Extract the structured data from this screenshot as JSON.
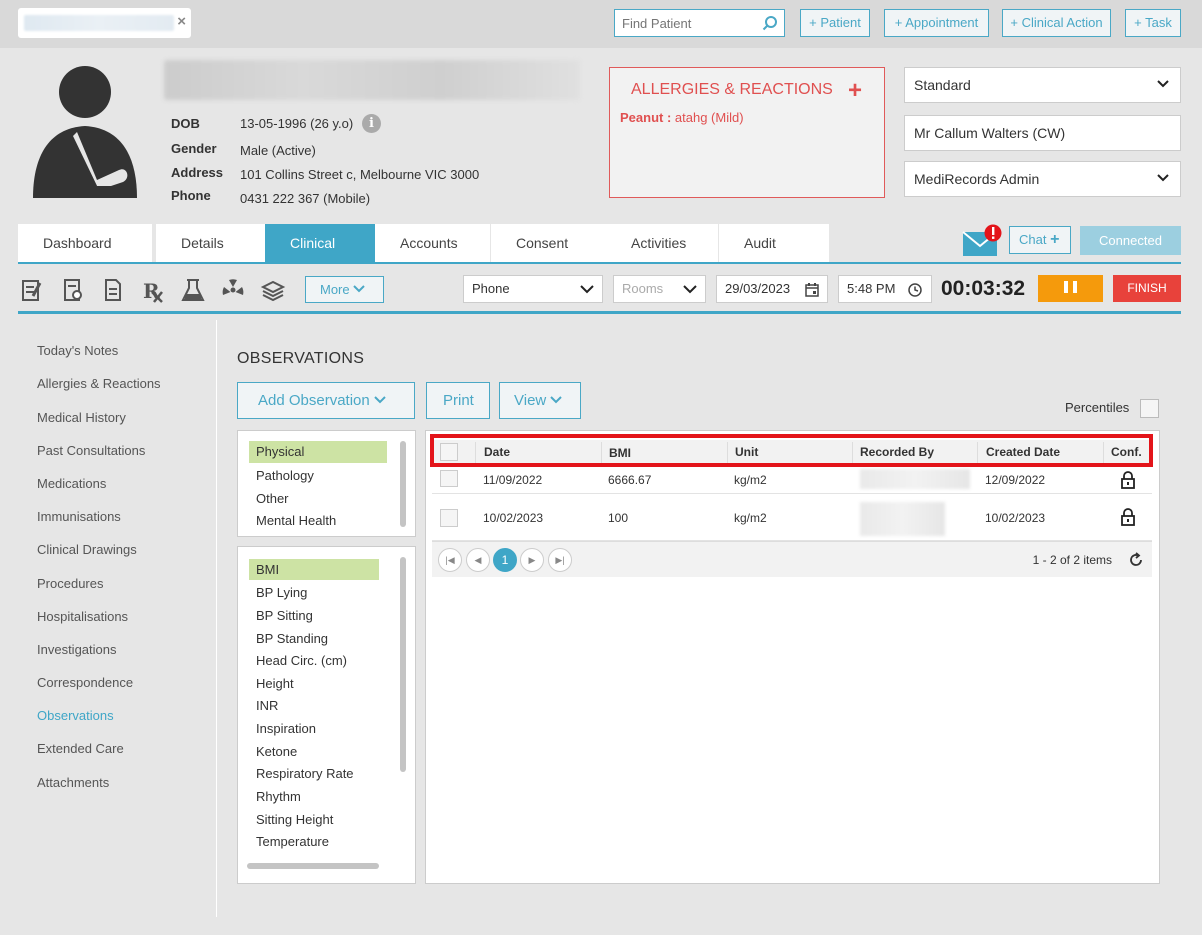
{
  "topbar": {
    "find_placeholder": "Find Patient",
    "buttons": [
      "+ Patient",
      "+ Appointment",
      "+ Clinical Action",
      "+ Task"
    ]
  },
  "patient": {
    "dob_label": "DOB",
    "dob": "13-05-1996 (26 y.o)",
    "gender_label": "Gender",
    "gender": "Male (Active)",
    "address_label": "Address",
    "address": "101 Collins Street c, Melbourne VIC 3000",
    "phone_label": "Phone",
    "phone": "0431 222 367 (Mobile)"
  },
  "allergies": {
    "title": "ALLERGIES & REACTIONS",
    "item_name": "Peanut : ",
    "item_detail": "atahg (Mild)"
  },
  "right_selects": {
    "standard": "Standard",
    "doctor": "Mr Callum Walters (CW)",
    "admin": "MediRecords Admin"
  },
  "tabs": [
    "Dashboard",
    "Details",
    "Clinical",
    "Accounts",
    "Consent",
    "Activities",
    "Audit"
  ],
  "active_tab": "Clinical",
  "chat_label": "Chat",
  "connected_label": "Connected",
  "toolbar": {
    "more_label": "More",
    "contact_type": "Phone",
    "rooms_placeholder": "Rooms",
    "date": "29/03/2023",
    "time": "5:48 PM",
    "timer": "00:03:32",
    "finish_label": "FINISH"
  },
  "sidebar": {
    "items": [
      "Today's Notes",
      "Allergies & Reactions",
      "Medical History",
      "Past Consultations",
      "Medications",
      "Immunisations",
      "Clinical Drawings",
      "Procedures",
      "Hospitalisations",
      "Investigations",
      "Correspondence",
      "Observations",
      "Extended Care",
      "Attachments"
    ],
    "active": "Observations"
  },
  "observations": {
    "title": "OBSERVATIONS",
    "add_label": "Add Observation",
    "print_label": "Print",
    "view_label": "View",
    "percentiles_label": "Percentiles",
    "categories": [
      "Physical",
      "Pathology",
      "Other",
      "Mental Health"
    ],
    "selected_category": "Physical",
    "types": [
      "BMI",
      "BP Lying",
      "BP Sitting",
      "BP Standing",
      "Head Circ. (cm)",
      "Height",
      "INR",
      "Inspiration",
      "Ketone",
      "Respiratory Rate",
      "Rhythm",
      "Sitting Height",
      "Temperature"
    ],
    "selected_type": "BMI",
    "columns": [
      "Date",
      "BMI",
      "Unit",
      "Recorded By",
      "Created Date",
      "Conf."
    ],
    "rows": [
      {
        "date": "11/09/2022",
        "bmi": "6666.67",
        "unit": "kg/m2",
        "created": "12/09/2022"
      },
      {
        "date": "10/02/2023",
        "bmi": "100",
        "unit": "kg/m2",
        "created": "10/02/2023"
      }
    ],
    "pager_current": "1",
    "pager_info": "1 - 2 of 2 items"
  },
  "colors": {
    "accent": "#3fa6c7",
    "allergy": "#e05050",
    "pause": "#f59a0c",
    "finish": "#e8423b",
    "highlight": "#e3141a",
    "selected_item": "#cde3a4"
  }
}
